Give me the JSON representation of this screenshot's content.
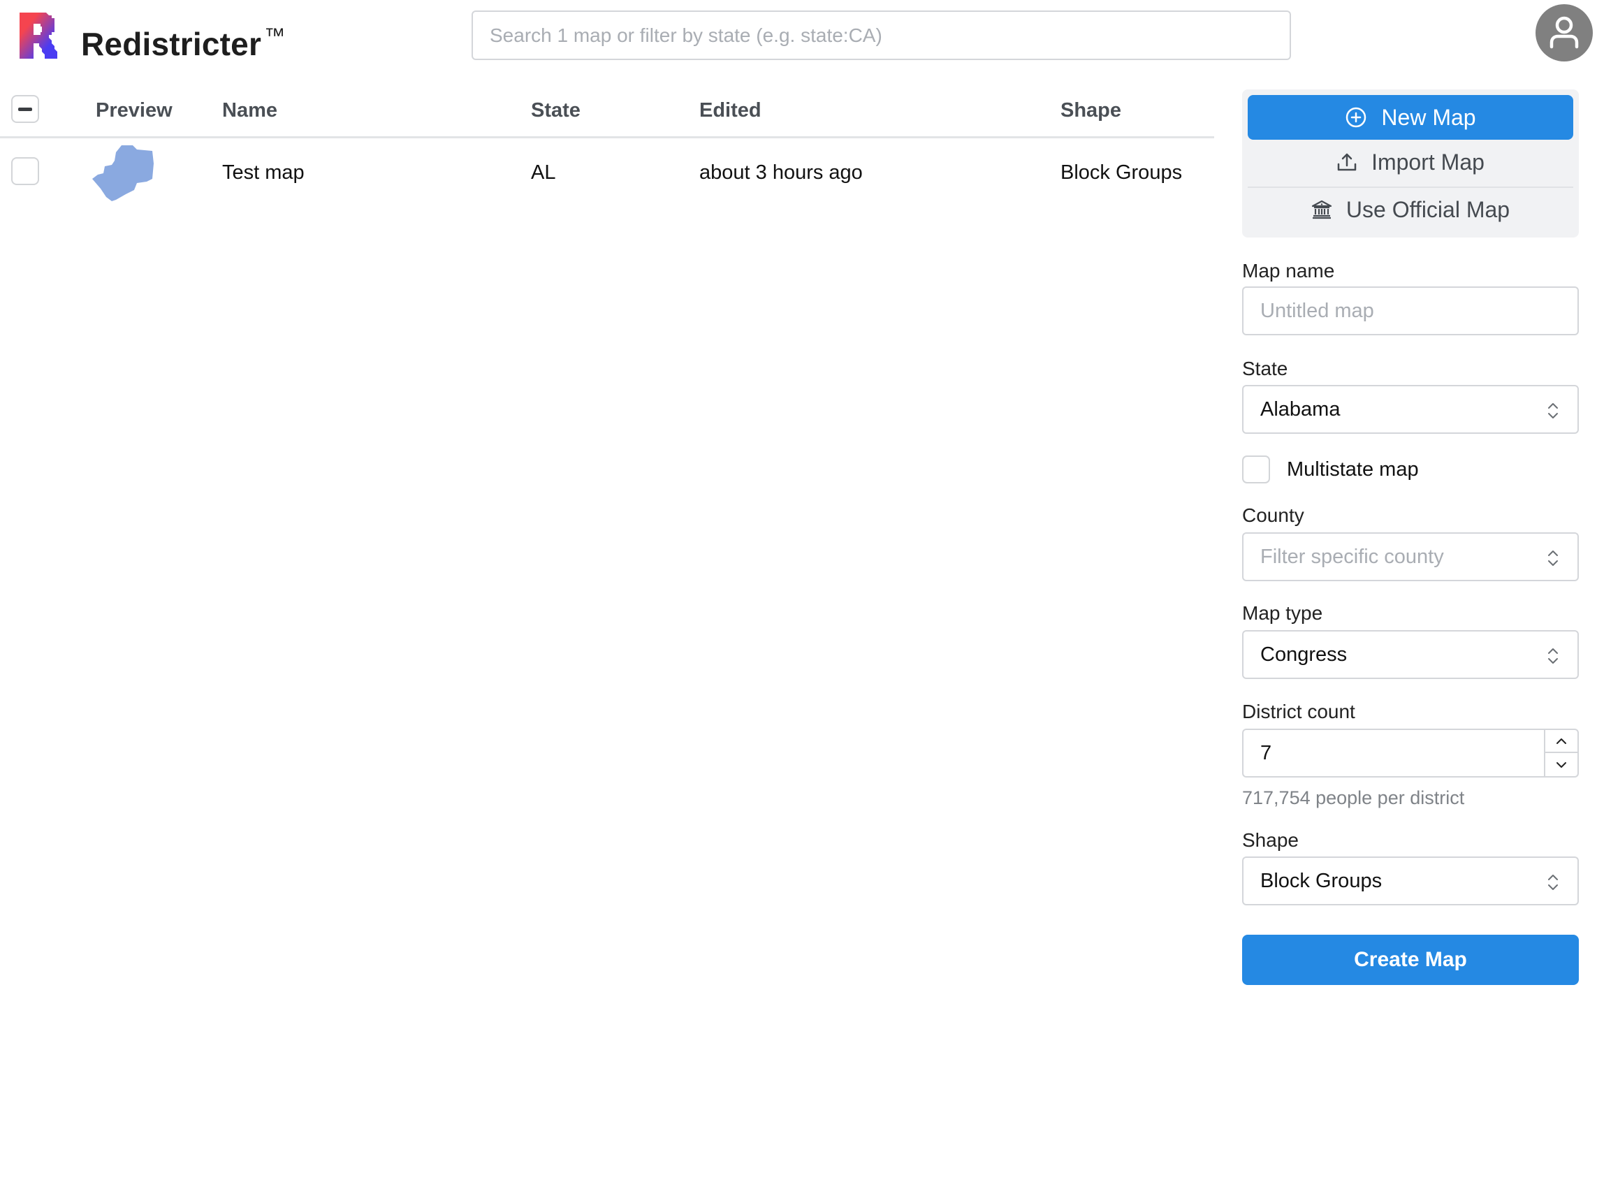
{
  "header": {
    "brand": "Redistricter",
    "trademark": "™",
    "search_placeholder": "Search 1 map or filter by state (e.g. state:CA)",
    "search_value": ""
  },
  "table": {
    "columns": [
      "Preview",
      "Name",
      "State",
      "Edited",
      "Shape"
    ],
    "rows": [
      {
        "name": "Test map",
        "state": "AL",
        "edited": "about 3 hours ago",
        "shape": "Block Groups",
        "selected": false
      }
    ],
    "select_all_state": "indeterminate"
  },
  "actions": {
    "new_map": "New Map",
    "import_map": "Import Map",
    "use_official_map": "Use Official Map"
  },
  "form": {
    "map_name_label": "Map name",
    "map_name_placeholder": "Untitled map",
    "map_name_value": "",
    "state_label": "State",
    "state_value": "Alabama",
    "multistate_label": "Multistate map",
    "multistate_checked": false,
    "county_label": "County",
    "county_placeholder": "Filter specific county",
    "map_type_label": "Map type",
    "map_type_value": "Congress",
    "district_count_label": "District count",
    "district_count_value": "7",
    "people_per_district": "717,754 people per district",
    "shape_label": "Shape",
    "shape_value": "Block Groups",
    "create_button": "Create Map"
  },
  "colors": {
    "primary": "#2589e3",
    "preview_fill": "#8aa9e0",
    "avatar_bg": "#808080",
    "logo_gradient_start": "#f5444f",
    "logo_gradient_end": "#4a3cf2"
  }
}
